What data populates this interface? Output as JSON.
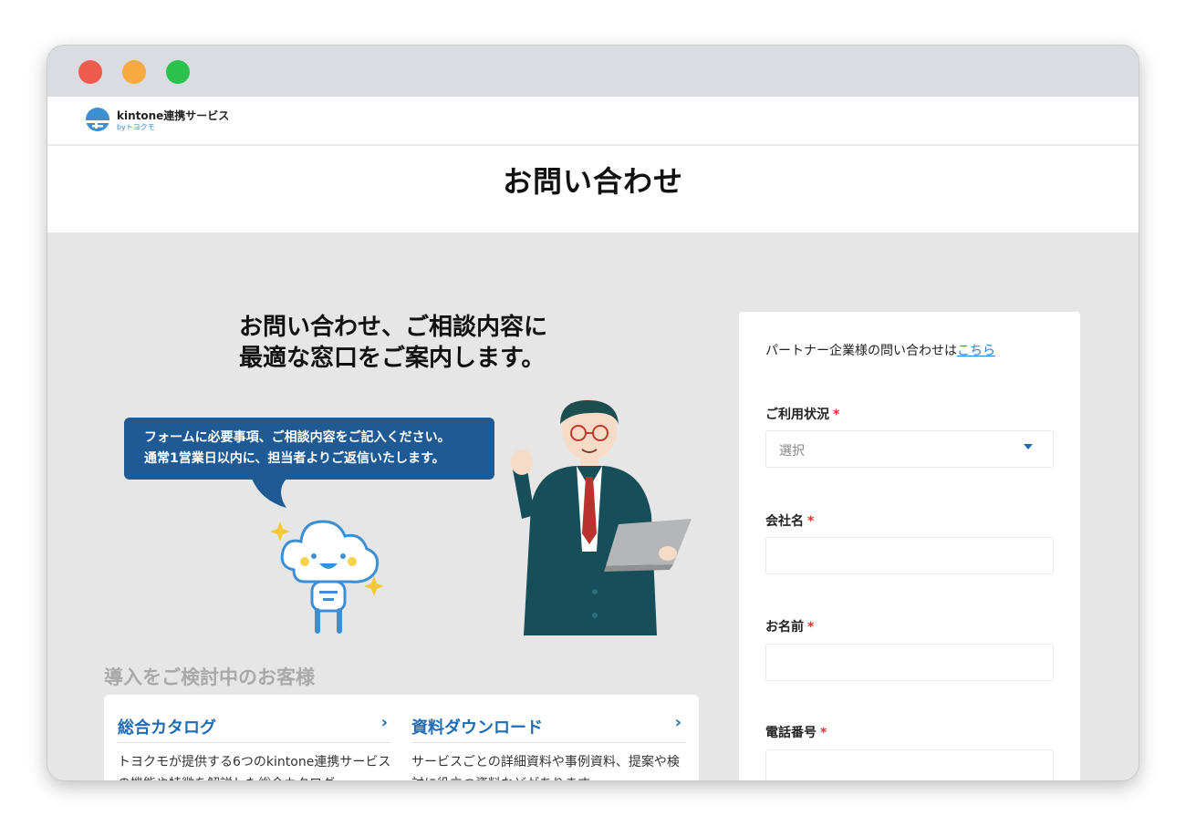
{
  "colors": {
    "dot_red": "#ef5b4f",
    "dot_yellow": "#f6aa40",
    "dot_green": "#2cc04d",
    "accent_blue": "#1f6cb5",
    "bubble_blue": "#1f5a94",
    "required_red": "#d8322e"
  },
  "header": {
    "logo_icon": "cloud-logo-icon",
    "logo_name": "kintone連携サービス",
    "logo_sub": "byトヨクモ"
  },
  "page": {
    "title": "お問い合わせ"
  },
  "hero": {
    "title_line1": "お問い合わせ、ご相談内容に",
    "title_line2": "最適な窓口をご案内します。",
    "bubble_line1": "フォームに必要事項、ご相談内容をご記入ください。",
    "bubble_line2": "通常1営業日以内に、担当者よりご返信いたします。"
  },
  "section": {
    "label": "導入をご検討中のお客様",
    "cards": [
      {
        "title": "総合カタログ",
        "arrow": "›",
        "desc": "トヨクモが提供する6つのkintone連携サービスの機能や特徴を解説した総合カタログ"
      },
      {
        "title": "資料ダウンロード",
        "arrow": "›",
        "desc": "サービスごとの詳細資料や事例資料、提案や検討に役立つ資料などがあります"
      }
    ]
  },
  "form": {
    "partner_text": "パートナー企業様の問い合わせは",
    "partner_link": "こちら",
    "required_mark": "*",
    "usage_label": "ご利用状況",
    "usage_value": "選択",
    "company_label": "会社名",
    "name_label": "お名前",
    "phone_label": "電話番号"
  }
}
